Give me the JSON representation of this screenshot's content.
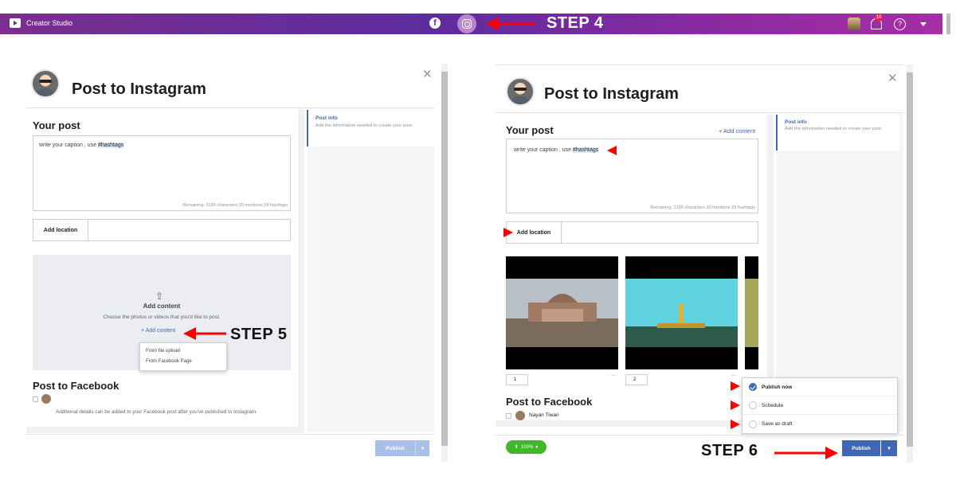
{
  "topbar": {
    "app_name": "Creator Studio",
    "fb_icon": "facebook-icon",
    "ig_icon": "instagram-icon",
    "notification_count": "10"
  },
  "steps": {
    "step4": "STEP 4",
    "step5": "STEP 5",
    "step6": "STEP 6"
  },
  "left": {
    "title": "Post to Instagram",
    "your_post": "Your post",
    "caption_prefix": "write your caption , use ",
    "caption_tag": "#hashtags",
    "remaining": "Remaining: 2166 characters 30 mentions 29 hashtags",
    "add_location": "Add location",
    "add_content_title": "Add content",
    "add_content_desc": "Choose the photos or videos that you'd like to post.",
    "add_content_link": "+ Add content",
    "dropdown": [
      "From file upload",
      "From Facebook Page"
    ],
    "post_to_facebook": "Post to Facebook",
    "fb_note": "Additional details can be added to your Facebook post after you've published to Instagram.",
    "publish": "Publish",
    "side_title": "Post info",
    "side_desc": "Add the information needed to create your post."
  },
  "right": {
    "title": "Post to Instagram",
    "your_post": "Your post",
    "add_content_link": "+ Add content",
    "caption_prefix": "write your caption , use ",
    "caption_tag": "#hashtags",
    "remaining": "Remaining: 2166 characters 30 mentions 29 hashtags",
    "add_location": "Add location",
    "media_numbers": [
      "1",
      "2"
    ],
    "more_glyph": "···",
    "post_to_facebook": "Post to Facebook",
    "fb_user": "Nayan Tiwari",
    "zoom": "100%",
    "publish_menu": [
      "Publish now",
      "Schedule",
      "Save as draft"
    ],
    "publish": "Publish",
    "side_title": "Post info",
    "side_desc": "Add the information needed to create your post."
  }
}
